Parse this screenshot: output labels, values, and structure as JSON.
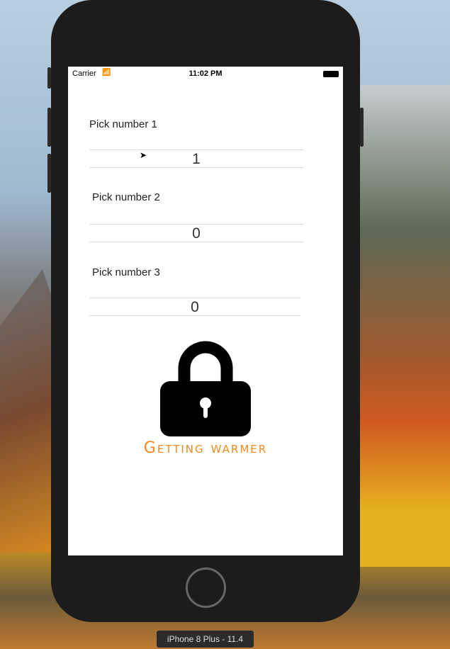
{
  "status": {
    "carrier": "Carrier",
    "time": "11:02 PM"
  },
  "pickers": [
    {
      "label": "Pick number 1",
      "value": "1"
    },
    {
      "label": "Pick number 2",
      "value": "0"
    },
    {
      "label": "Pick number 3",
      "value": "0"
    }
  ],
  "message": "Getting warmer",
  "message_color": "#f58a1f",
  "device_label": "iPhone 8 Plus - 11.4"
}
